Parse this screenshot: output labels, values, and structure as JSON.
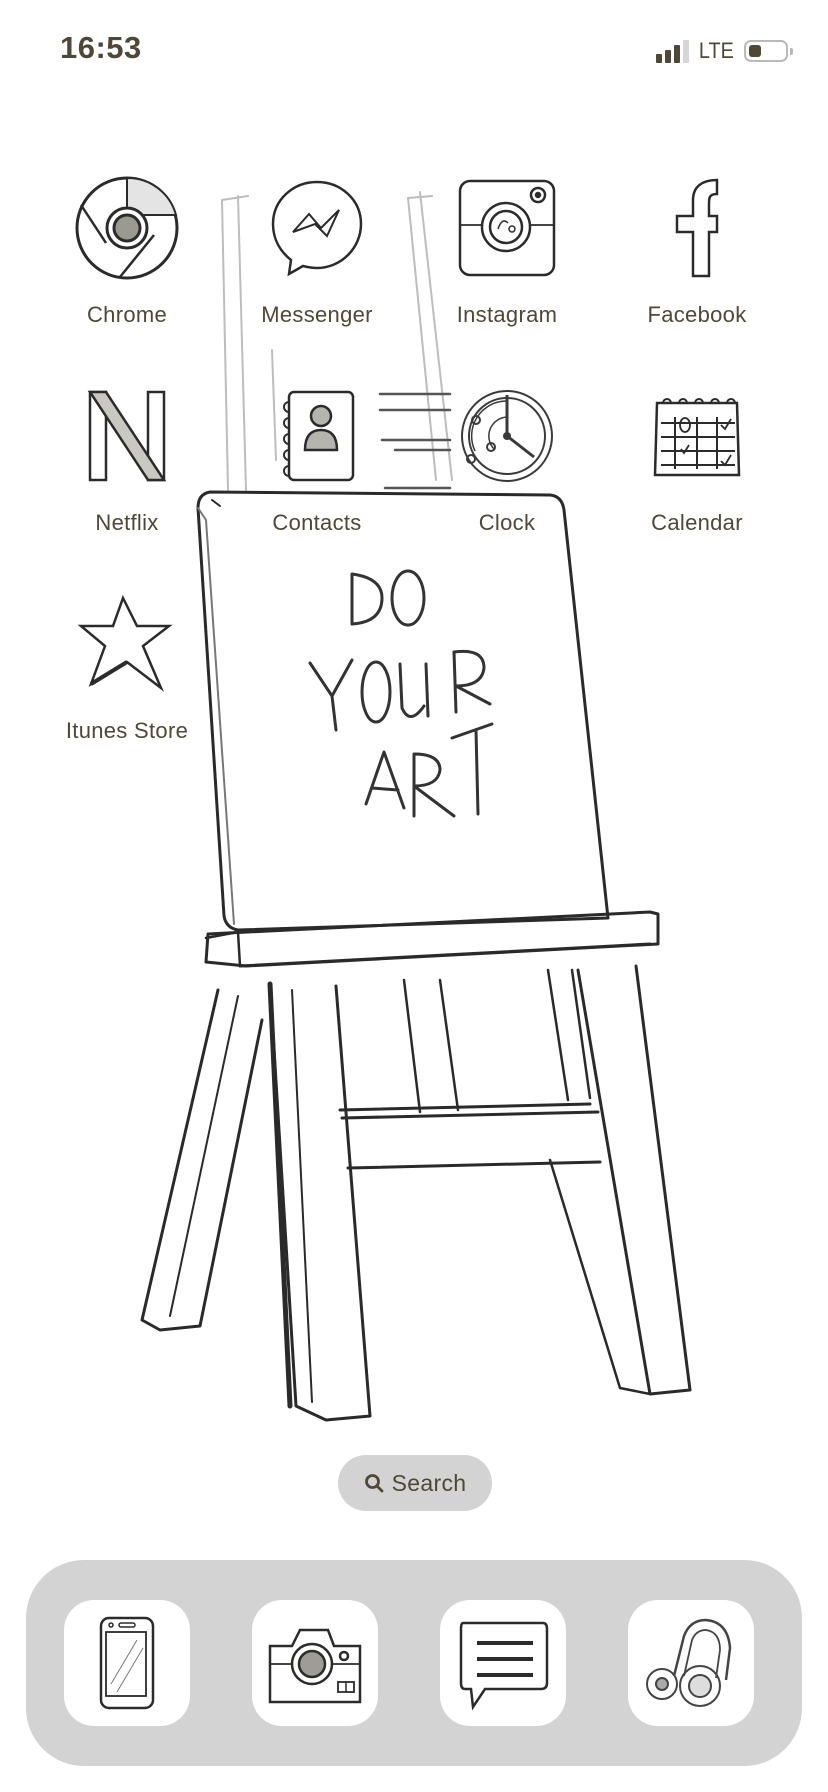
{
  "status_bar": {
    "time": "16:53",
    "network": "LTE",
    "signal_bars_active": 3,
    "signal_bars_total": 4,
    "battery_level_percent": 35
  },
  "wallpaper": {
    "subject": "easel-sketch",
    "canvas_text": [
      "DO",
      "YOUR",
      "ART"
    ]
  },
  "home_apps": [
    {
      "label": "Chrome",
      "icon": "chrome-icon"
    },
    {
      "label": "Messenger",
      "icon": "messenger-icon"
    },
    {
      "label": "Instagram",
      "icon": "instagram-icon"
    },
    {
      "label": "Facebook",
      "icon": "facebook-icon"
    },
    {
      "label": "Netflix",
      "icon": "netflix-icon"
    },
    {
      "label": "Contacts",
      "icon": "contacts-icon"
    },
    {
      "label": "Clock",
      "icon": "clock-icon"
    },
    {
      "label": "Calendar",
      "icon": "calendar-icon"
    },
    {
      "label": "Itunes Store",
      "icon": "star-icon"
    }
  ],
  "search": {
    "label": "Search",
    "icon": "search-icon"
  },
  "dock": [
    {
      "name": "Phone",
      "icon": "phone-icon"
    },
    {
      "name": "Camera",
      "icon": "camera-icon"
    },
    {
      "name": "Messages",
      "icon": "message-icon"
    },
    {
      "name": "Music",
      "icon": "headphones-icon"
    }
  ],
  "colors": {
    "text": "#4f4836",
    "pill_bg": "#d3d3d3",
    "dock_bg": "#d3d3d3",
    "sketch_stroke": "#2a2a2a"
  }
}
